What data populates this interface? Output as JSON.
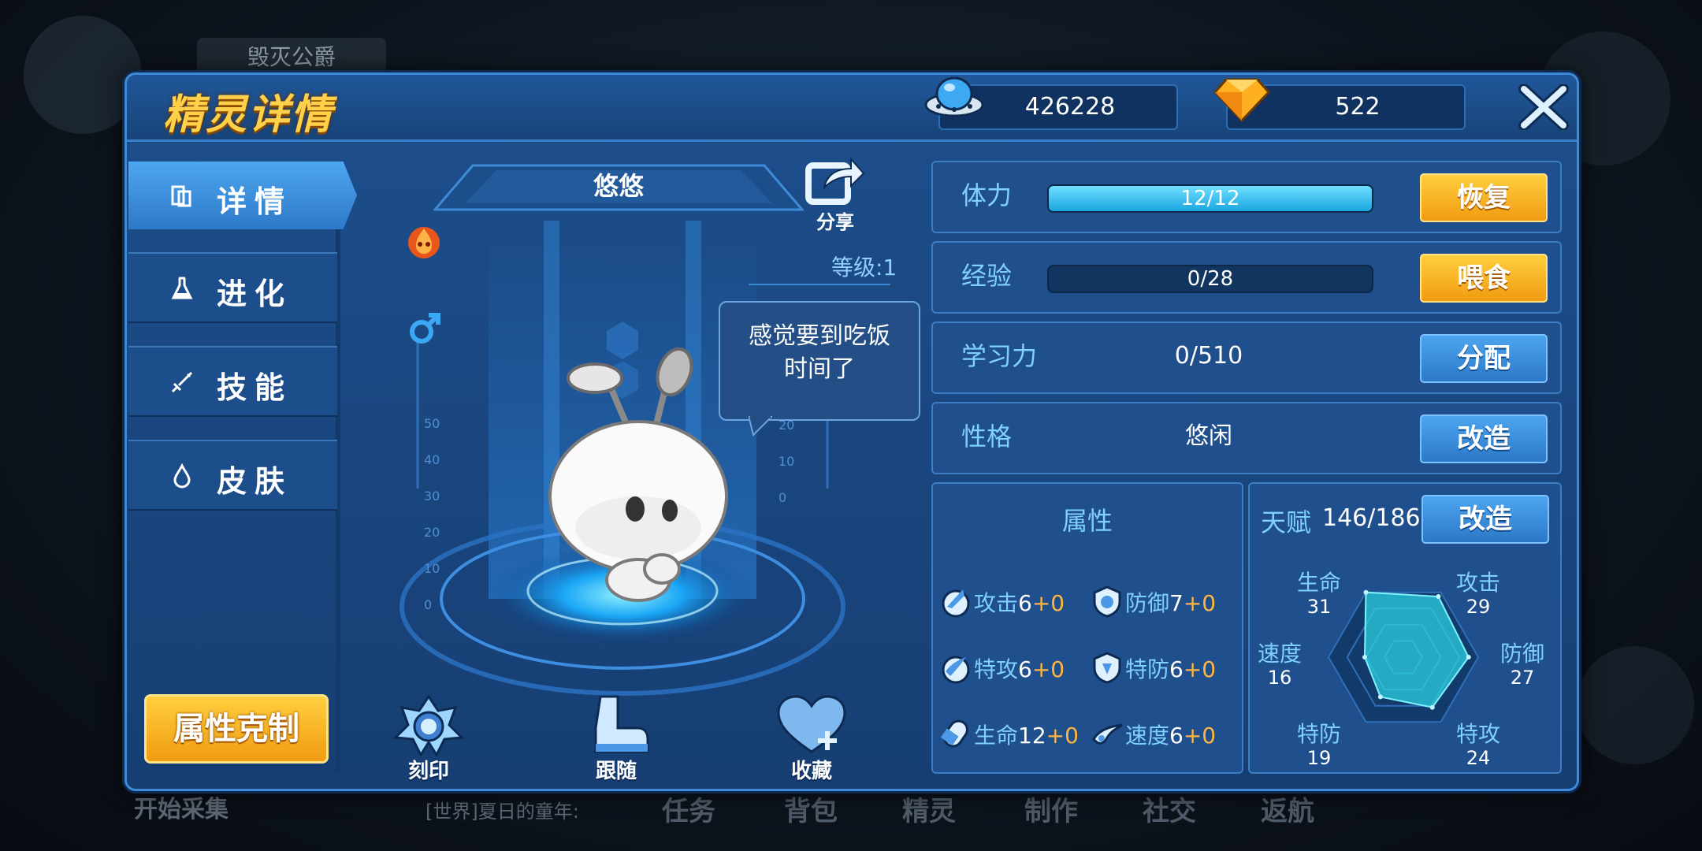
{
  "background": {
    "top_name": "毁灭公爵",
    "collect_label": "开始采集",
    "chat_text": "[世界]夏日的童年:",
    "bottom_nav": [
      "任务",
      "背包",
      "精灵",
      "制作",
      "社交",
      "返航"
    ]
  },
  "header": {
    "title": "精灵详情",
    "currency_1": "426228",
    "currency_2": "522"
  },
  "tabs": [
    {
      "label": "详情",
      "icon": "book-icon"
    },
    {
      "label": "进化",
      "icon": "flask-icon"
    },
    {
      "label": "技能",
      "icon": "sword-icon"
    },
    {
      "label": "皮肤",
      "icon": "drop-icon"
    }
  ],
  "type_counter_label": "属性克制",
  "pet": {
    "name": "悠悠",
    "share_label": "分享",
    "level_text": "等级:1",
    "speech_line1": "感觉要到吃饭",
    "speech_line2": "时间了",
    "gauge_left": [
      "50",
      "40",
      "30",
      "20",
      "10",
      "0"
    ],
    "gauge_right": [
      "20",
      "10",
      "0"
    ]
  },
  "actions": [
    {
      "label": "刻印",
      "icon": "seal-icon"
    },
    {
      "label": "跟随",
      "icon": "boot-icon"
    },
    {
      "label": "收藏",
      "icon": "heart-icon"
    }
  ],
  "stats": {
    "stamina": {
      "label": "体力",
      "value": "12/12",
      "fraction": 1.0,
      "button": "恢复"
    },
    "exp": {
      "label": "经验",
      "value": "0/28",
      "fraction": 0.0,
      "button": "喂食"
    },
    "learning": {
      "label": "学习力",
      "value": "0/510",
      "button": "分配"
    },
    "nature": {
      "label": "性格",
      "value": "悠闲",
      "button": "改造"
    }
  },
  "attributes": {
    "title": "属性",
    "items": [
      {
        "name": "攻击",
        "value": "6",
        "plus": "+0"
      },
      {
        "name": "防御",
        "value": "7",
        "plus": "+0"
      },
      {
        "name": "特攻",
        "value": "6",
        "plus": "+0"
      },
      {
        "name": "特防",
        "value": "6",
        "plus": "+0"
      },
      {
        "name": "生命",
        "value": "12",
        "plus": "+0"
      },
      {
        "name": "速度",
        "value": "6",
        "plus": "+0"
      }
    ]
  },
  "talent": {
    "label": "天赋",
    "value": "146/186",
    "button": "改造",
    "radar": {
      "max": 31,
      "axes": [
        {
          "name": "生命",
          "value": 31
        },
        {
          "name": "攻击",
          "value": 29
        },
        {
          "name": "防御",
          "value": 27
        },
        {
          "name": "特攻",
          "value": 24
        },
        {
          "name": "特防",
          "value": 19
        },
        {
          "name": "速度",
          "value": 16
        }
      ]
    }
  },
  "colors": {
    "accent_yellow": "#ffcf3f",
    "accent_blue": "#4da5ef",
    "label_cyan": "#7fd0ff",
    "radar_fill": "#2ed0e0"
  }
}
